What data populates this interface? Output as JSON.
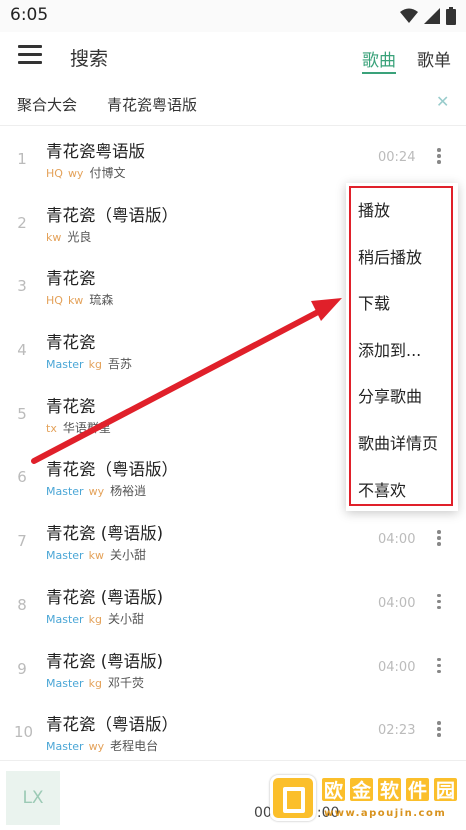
{
  "status": {
    "time": "6:05"
  },
  "appbar": {
    "title": "搜索",
    "tabs": [
      "歌曲",
      "歌单"
    ]
  },
  "search": {
    "source": "聚合大会",
    "query": "青花瓷粤语版"
  },
  "songs": [
    {
      "index": "1",
      "name": "青花瓷粤语版",
      "q": "HQ",
      "src": "wy",
      "artist": "付博文",
      "duration": "00:24"
    },
    {
      "index": "2",
      "name": "青花瓷（粤语版）",
      "q": "",
      "src": "kw",
      "artist": "光良",
      "duration": ""
    },
    {
      "index": "3",
      "name": "青花瓷",
      "q": "HQ",
      "src": "kw",
      "artist": "琉森",
      "duration": ""
    },
    {
      "index": "4",
      "name": "青花瓷",
      "q": "Master",
      "src": "kg",
      "artist": "吾苏",
      "duration": ""
    },
    {
      "index": "5",
      "name": "青花瓷",
      "q": "",
      "src": "tx",
      "artist": "华语群星",
      "duration": ""
    },
    {
      "index": "6",
      "name": "青花瓷（粤语版）",
      "q": "Master",
      "src": "wy",
      "artist": "杨裕逍",
      "duration": ""
    },
    {
      "index": "7",
      "name": "青花瓷 (粤语版)",
      "q": "Master",
      "src": "kw",
      "artist": "关小甜",
      "duration": "04:00"
    },
    {
      "index": "8",
      "name": "青花瓷 (粤语版)",
      "q": "Master",
      "src": "kg",
      "artist": "关小甜",
      "duration": "04:00"
    },
    {
      "index": "9",
      "name": "青花瓷 (粤语版)",
      "q": "Master",
      "src": "kg",
      "artist": "邓千荧",
      "duration": "04:00"
    },
    {
      "index": "10",
      "name": "青花瓷（粤语版）",
      "q": "Master",
      "src": "wy",
      "artist": "老程电台",
      "duration": "02:23"
    }
  ],
  "popup_menu": [
    "播放",
    "稍后播放",
    "下载",
    "添加到...",
    "分享歌曲",
    "歌曲详情页",
    "不喜欢"
  ],
  "player": {
    "cover_text": "LX",
    "time": "00:00/00:00"
  },
  "watermark": {
    "chars": [
      "欧",
      "金",
      "软",
      "件",
      "园"
    ],
    "url": "www.apoujin.com"
  },
  "colors": {
    "accent": "#3aa27a",
    "highlight": "#e0202a",
    "quality_hq": "#e4a25a",
    "quality_master": "#4aa6d6"
  }
}
